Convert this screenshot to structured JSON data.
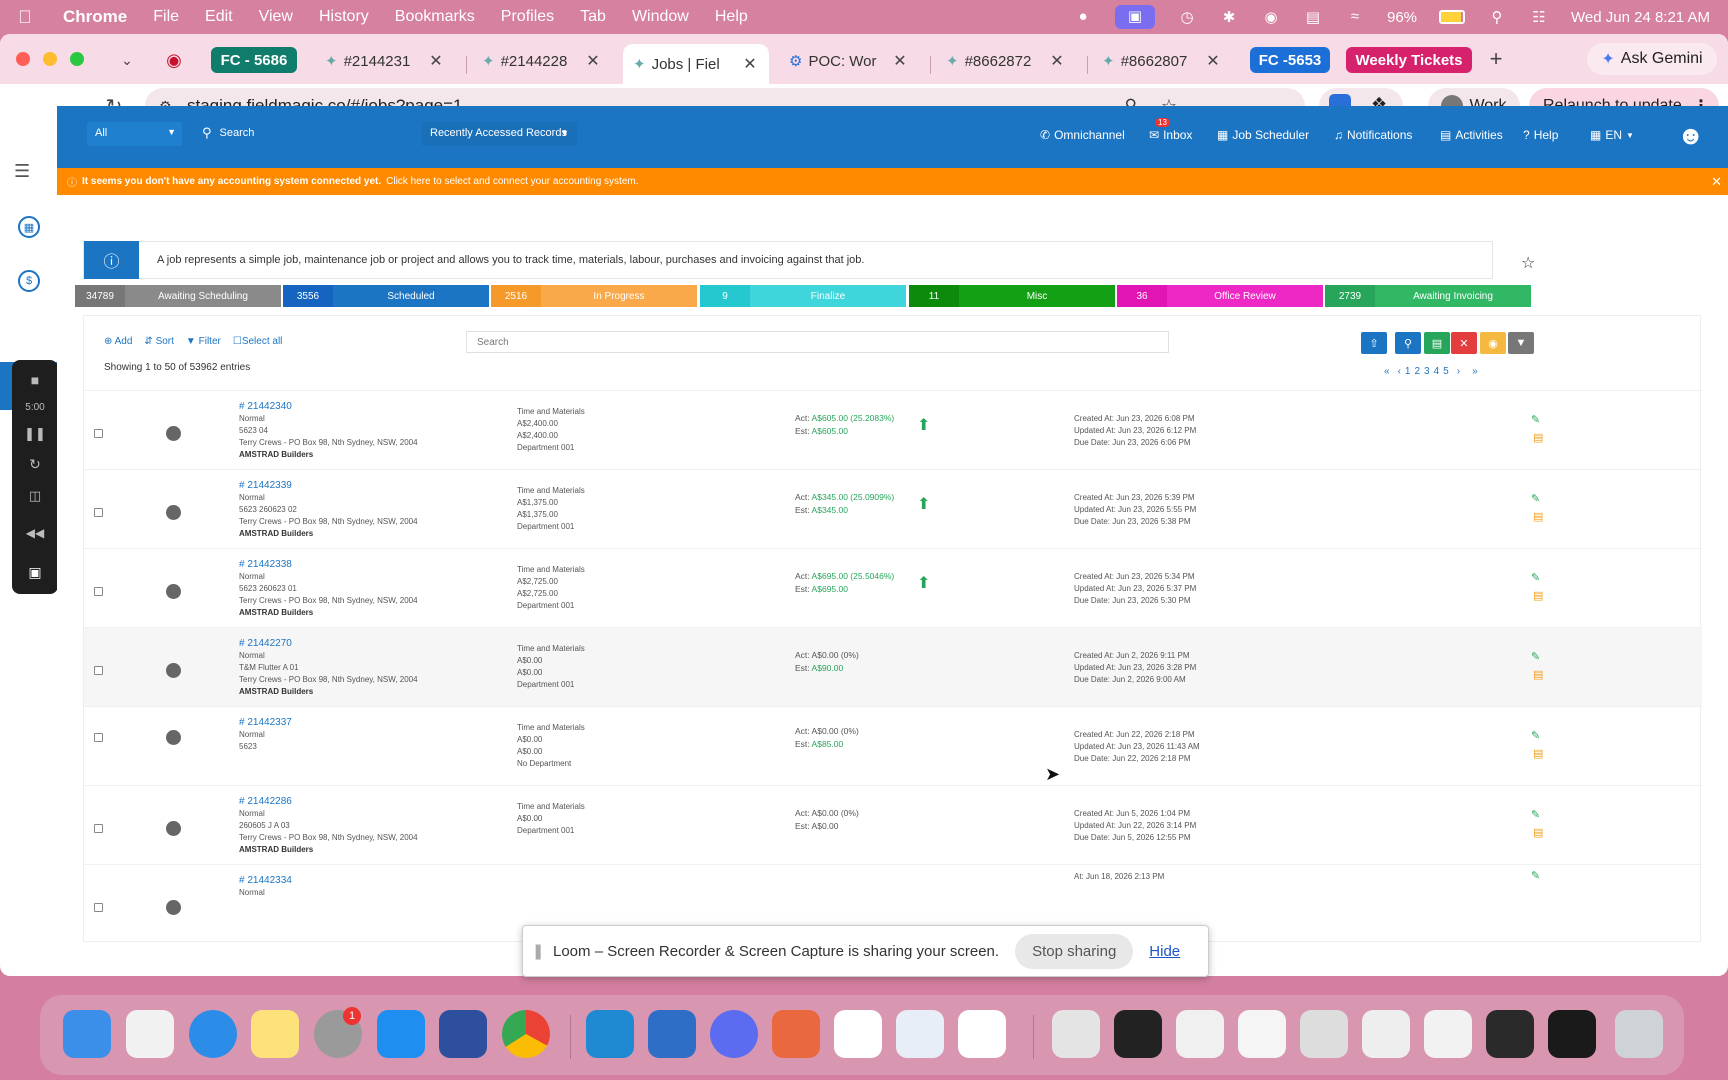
{
  "menubar": {
    "app": "Chrome",
    "items": [
      "File",
      "Edit",
      "View",
      "History",
      "Bookmarks",
      "Profiles",
      "Tab",
      "Window",
      "Help"
    ],
    "battery": "96%",
    "datetime": "Wed Jun 24  8:21 AM"
  },
  "tabs": [
    {
      "label": "FC - 5686",
      "group": true,
      "color": "#0f7c6c"
    },
    {
      "label": "#2144231"
    },
    {
      "label": "#2144228"
    },
    {
      "label": "Jobs | Fiel",
      "active": true
    },
    {
      "label": "POC: Wor"
    },
    {
      "label": "#8662872"
    },
    {
      "label": "#8662807"
    },
    {
      "label": "FC -5653",
      "group": true,
      "color": "#1d6fd8"
    },
    {
      "label": "Weekly Tickets",
      "group": true,
      "color": "#d6226d"
    }
  ],
  "ask_gemini": "Ask Gemini",
  "address": {
    "url": "staging.fieldmagic.co/#/jobs?page=1",
    "ext_badge": "9+",
    "profile": "Work",
    "relaunch": "Relaunch to update"
  },
  "appbar": {
    "scope": "All",
    "search_placeholder": "Search",
    "recent": "Recently Accessed Records",
    "omnichannel": "Omnichannel",
    "inbox": "Inbox",
    "inbox_count": "13",
    "scheduler": "Job Scheduler",
    "notifications": "Notifications",
    "activities": "Activities",
    "help": "Help",
    "lang": "EN"
  },
  "warning": {
    "bold": "It seems you don't have any accounting system connected yet.",
    "link": "Click here to select and connect your accounting system."
  },
  "loom_timer": "5:00",
  "info": "A job represents a simple job, maintenance job or project and allows you to track time, materials, labour, purchases and invoicing against that job.",
  "statuses": [
    {
      "count": "34789",
      "label": "Awaiting Scheduling",
      "c": "#777777",
      "l": "#8a8a8a"
    },
    {
      "count": "3556",
      "label": "Scheduled",
      "c": "#1565c0",
      "l": "#1c75c3"
    },
    {
      "count": "2516",
      "label": "In Progress",
      "c": "#f59a2a",
      "l": "#f9a94a"
    },
    {
      "count": "9",
      "label": "Finalize",
      "c": "#25c8cf",
      "l": "#3fd6db"
    },
    {
      "count": "11",
      "label": "Misc",
      "c": "#0b8a0b",
      "l": "#14a014"
    },
    {
      "count": "36",
      "label": "Office Review",
      "c": "#e015b3",
      "l": "#ee28c4"
    },
    {
      "count": "2739",
      "label": "Awaiting Invoicing",
      "c": "#27a55a",
      "l": "#32b865"
    }
  ],
  "table": {
    "actions": {
      "add": "Add",
      "sort": "Sort",
      "filter": "Filter",
      "select_all": "Select all"
    },
    "showing": "Showing 1 to 50 of 53962 entries",
    "search_placeholder": "Search",
    "pages": [
      "1",
      "2",
      "3",
      "4",
      "5"
    ],
    "rows": [
      {
        "id": "# 21442340",
        "priority": "Normal",
        "ref": "5623 04",
        "address": "Terry Crews - PO Box 98, Nth Sydney, NSW, 2004",
        "customer": "AMSTRAD Builders",
        "type": "Time and Materials",
        "amt1": "A$2,400.00",
        "amt2": "A$2,400.00",
        "dept": "Department 001",
        "act": "A$605.00 (25.2083%)",
        "act_green": true,
        "est": "A$605.00",
        "up": true,
        "created": "Created At: Jun 23, 2026 6:08 PM",
        "updated": "Updated At: Jun 23, 2026 6:12 PM",
        "due": "Due Date: Jun 23, 2026 6:06 PM"
      },
      {
        "id": "# 21442339",
        "priority": "Normal",
        "ref": "5623 260623 02",
        "address": "Terry Crews - PO Box 98, Nth Sydney, NSW, 2004",
        "customer": "AMSTRAD Builders",
        "type": "Time and Materials",
        "amt1": "A$1,375.00",
        "amt2": "A$1,375.00",
        "dept": "Department 001",
        "act": "A$345.00 (25.0909%)",
        "act_green": true,
        "est": "A$345.00",
        "up": true,
        "created": "Created At: Jun 23, 2026 5:39 PM",
        "updated": "Updated At: Jun 23, 2026 5:55 PM",
        "due": "Due Date: Jun 23, 2026 5:38 PM"
      },
      {
        "id": "# 21442338",
        "priority": "Normal",
        "ref": "5623 260623 01",
        "address": "Terry Crews - PO Box 98, Nth Sydney, NSW, 2004",
        "customer": "AMSTRAD Builders",
        "type": "Time and Materials",
        "amt1": "A$2,725.00",
        "amt2": "A$2,725.00",
        "dept": "Department 001",
        "act": "A$695.00 (25.5046%)",
        "act_green": true,
        "est": "A$695.00",
        "up": true,
        "created": "Created At: Jun 23, 2026 5:34 PM",
        "updated": "Updated At: Jun 23, 2026 5:37 PM",
        "due": "Due Date: Jun 23, 2026 5:30 PM"
      },
      {
        "id": "# 21442270",
        "priority": "Normal",
        "ref": "T&M Flutter A 01",
        "address": "Terry Crews - PO Box 98, Nth Sydney, NSW, 2004",
        "customer": "AMSTRAD Builders",
        "type": "Time and Materials",
        "amt1": "A$0.00",
        "amt2": "A$0.00",
        "dept": "Department 001",
        "act": "A$0.00 (0%)",
        "act_green": false,
        "est": "A$90.00",
        "up": false,
        "created": "Created At: Jun 2, 2026 9:11 PM",
        "updated": "Updated At: Jun 23, 2026 3:28 PM",
        "due": "Due Date: Jun 2, 2026 9:00 AM",
        "hover": true
      },
      {
        "id": "# 21442337",
        "priority": "Normal",
        "ref": "5623",
        "address": "",
        "customer": "",
        "type": "Time and Materials",
        "amt1": "A$0.00",
        "amt2": "A$0.00",
        "dept": "No Department",
        "act": "A$0.00 (0%)",
        "act_green": false,
        "est": "A$85.00",
        "up": false,
        "created": "Created At: Jun 22, 2026 2:18 PM",
        "updated": "Updated At: Jun 23, 2026 11:43 AM",
        "due": "Due Date: Jun 22, 2026 2:18 PM"
      },
      {
        "id": "# 21442286",
        "priority": "Normal",
        "ref": "260605 J A 03",
        "address": "Terry Crews - PO Box 98, Nth Sydney, NSW, 2004",
        "customer": "AMSTRAD Builders",
        "type": "Time and Materials",
        "amt1": "A$0.00",
        "amt2": "",
        "dept": "Department 001",
        "act": "A$0.00 (0%)",
        "act_green": false,
        "est": "A$0.00",
        "est_gray": true,
        "up": false,
        "created": "Created At: Jun 5, 2026 1:04 PM",
        "updated": "Updated At: Jun 22, 2026 3:14 PM",
        "due": "Due Date: Jun 5, 2026 12:55 PM"
      },
      {
        "id": "# 21442334",
        "priority": "Normal",
        "ref": "",
        "address": "",
        "customer": "",
        "type": "",
        "amt1": "",
        "amt2": "",
        "dept": "",
        "act": "",
        "act_green": false,
        "est": "",
        "up": false,
        "created": "At: Jun 18, 2026 2:13 PM",
        "updated": "",
        "due": ""
      }
    ]
  },
  "loom": {
    "message": "Loom – Screen Recorder & Screen Capture is sharing your screen.",
    "stop": "Stop sharing",
    "hide": "Hide"
  },
  "dock_badges": {
    "settings": "1"
  }
}
